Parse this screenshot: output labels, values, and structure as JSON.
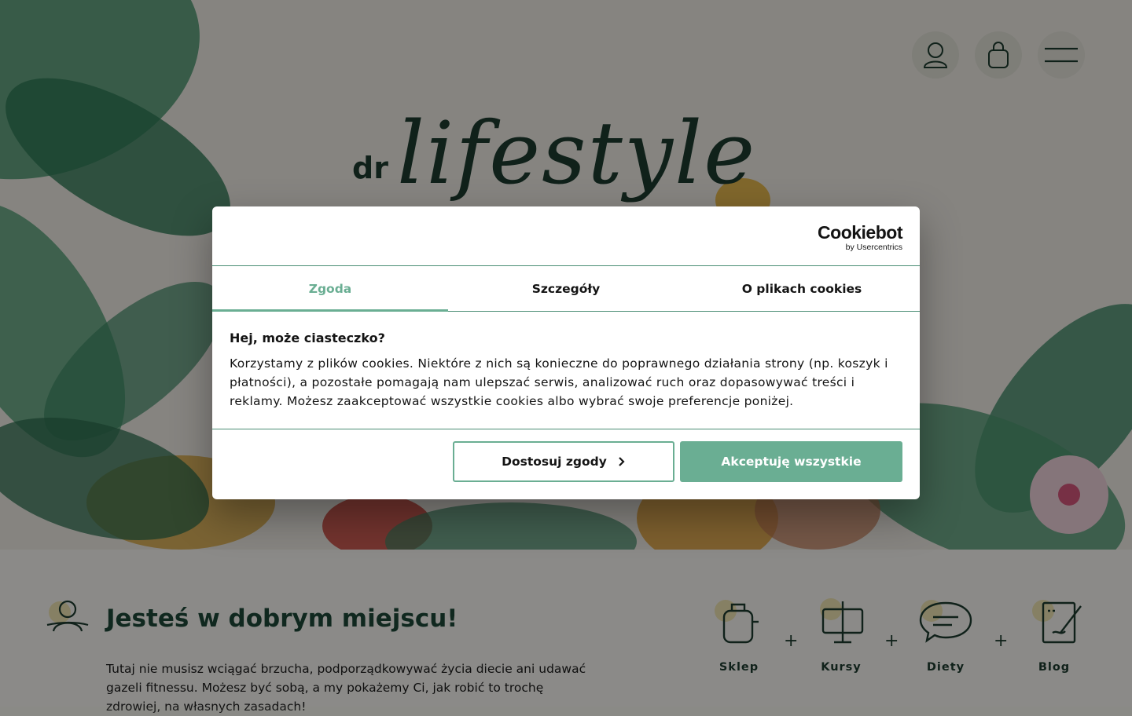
{
  "header": {
    "icons": [
      "user-icon",
      "bag-icon",
      "menu-icon"
    ]
  },
  "logo": {
    "prefix": "dr",
    "script": "lifestyle"
  },
  "intro": {
    "heading": "Jesteś w dobrym miejscu!",
    "text": "Tutaj nie musisz wciągać brzucha, podporządkowywać życia diecie ani udawać gazeli fitnessu. Możesz być sobą, a my pokażemy Ci, jak robić to trochę zdrowiej, na własnych zasadach!"
  },
  "categories": [
    {
      "label": "Sklep",
      "icon": "pot-icon"
    },
    {
      "label": "Kursy",
      "icon": "presentation-board-icon"
    },
    {
      "label": "Diety",
      "icon": "speech-bubble-icon"
    },
    {
      "label": "Blog",
      "icon": "notebook-pen-icon"
    }
  ],
  "plus_sign": "+",
  "cookie_dialog": {
    "brand": "Cookiebot",
    "brand_sub": "by Usercentrics",
    "tabs": [
      {
        "label": "Zgoda",
        "active": true
      },
      {
        "label": "Szczegóły",
        "active": false
      },
      {
        "label": "O plikach cookies",
        "active": false
      }
    ],
    "title": "Hej, może ciasteczko?",
    "text": "Korzystamy z plików cookies. Niektóre z nich są konieczne do poprawnego działania strony (np. koszyk i płatności), a pozostałe pomagają nam ulepszać serwis, analizować ruch oraz dopasowywać treści i reklamy. Możesz zaakceptować wszystkie cookies albo wybrać swoje preferencje poniżej.",
    "customize_label": "Dostosuj zgody",
    "accept_label": "Akceptuję wszystkie"
  },
  "colors": {
    "accent": "#6aae93",
    "dark_green": "#1e3c30",
    "overlay": "rgba(0,0,0,0.45)"
  }
}
